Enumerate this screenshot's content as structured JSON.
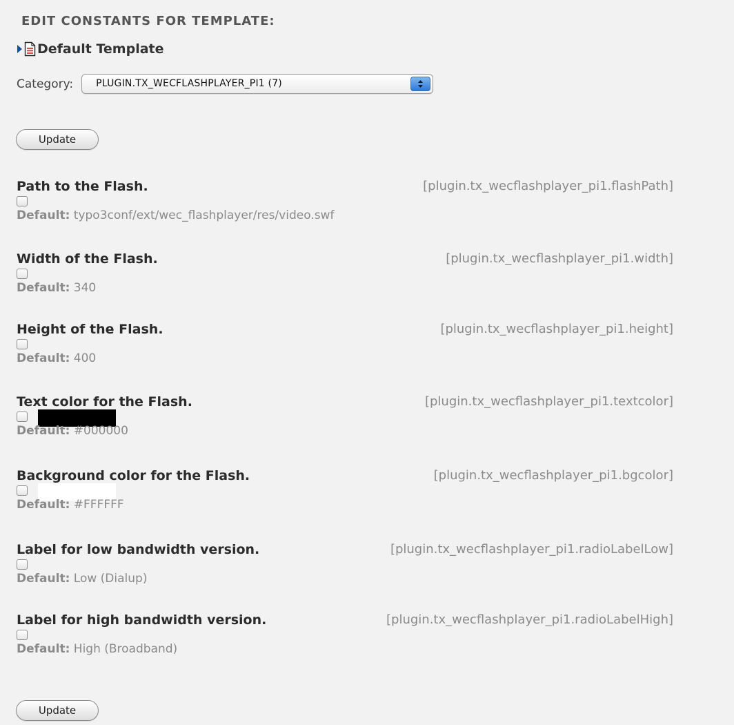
{
  "page": {
    "heading": "EDIT CONSTANTS FOR TEMPLATE:",
    "template_title": "Default Template",
    "template_icon": "document-icon",
    "expand_icon": "arrow-right-icon"
  },
  "category": {
    "label": "Category:",
    "selected": "PLUGIN.TX_WECFLASHPLAYER_PI1 (7)"
  },
  "buttons": {
    "update_top": "Update",
    "update_bottom": "Update"
  },
  "default_label": "Default:",
  "constants": [
    {
      "title": "Path to the Flash.",
      "path": "[plugin.tx_wecflashplayer_pi1.flashPath]",
      "default": "typo3conf/ext/wec_flashplayer/res/video.swf"
    },
    {
      "title": "Width of the Flash.",
      "path": "[plugin.tx_wecflashplayer_pi1.width]",
      "default": "340"
    },
    {
      "title": "Height of the Flash.",
      "path": "[plugin.tx_wecflashplayer_pi1.height]",
      "default": "400"
    },
    {
      "title": "Text color for the Flash.",
      "path": "[plugin.tx_wecflashplayer_pi1.textcolor]",
      "default": "#000000",
      "swatch_color": "#000000"
    },
    {
      "title": "Background color for the Flash.",
      "path": "[plugin.tx_wecflashplayer_pi1.bgcolor]",
      "default": "#FFFFFF",
      "swatch_color": "#FFFFFF"
    },
    {
      "title": "Label for low bandwidth version.",
      "path": "[plugin.tx_wecflashplayer_pi1.radioLabelLow]",
      "default": "Low (Dialup)"
    },
    {
      "title": "Label for high bandwidth version.",
      "path": "[plugin.tx_wecflashplayer_pi1.radioLabelHigh]",
      "default": "High (Broadband)"
    }
  ]
}
